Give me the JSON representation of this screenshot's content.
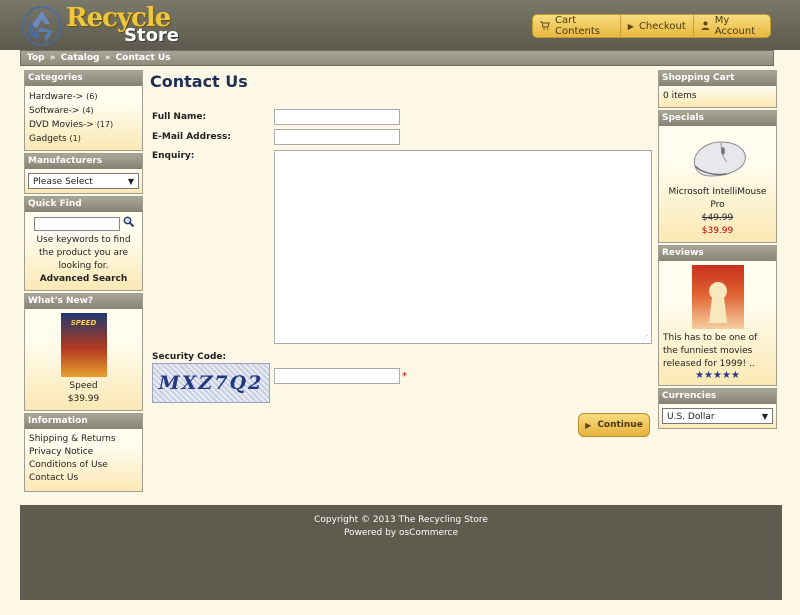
{
  "header": {
    "logo": {
      "line1": "Recycle",
      "line2": "Store"
    },
    "nav": [
      {
        "label": "Cart Contents",
        "icon": "cart-icon"
      },
      {
        "label": "Checkout",
        "icon": "arrow-right-icon"
      },
      {
        "label": "My Account",
        "icon": "person-icon"
      }
    ]
  },
  "breadcrumb": [
    "Top",
    "Catalog",
    "Contact Us"
  ],
  "breadcrumb_separator": "»",
  "left": {
    "categories": {
      "title": "Categories",
      "items": [
        {
          "label": "Hardware->",
          "count": "(6)"
        },
        {
          "label": "Software->",
          "count": "(4)"
        },
        {
          "label": "DVD Movies->",
          "count": "(17)"
        },
        {
          "label": "Gadgets",
          "count": "(1)"
        }
      ]
    },
    "manufacturers": {
      "title": "Manufacturers",
      "selected": "Please Select"
    },
    "quick_find": {
      "title": "Quick Find",
      "help": "Use keywords to find the product you are looking for.",
      "advanced": "Advanced Search"
    },
    "whats_new": {
      "title": "What's New?",
      "product": "Speed",
      "price": "$39.99",
      "cover_text": "SPEED"
    },
    "information": {
      "title": "Information",
      "links": [
        "Shipping & Returns",
        "Privacy Notice",
        "Conditions of Use",
        "Contact Us"
      ]
    }
  },
  "main": {
    "title": "Contact Us",
    "labels": {
      "full_name": "Full Name:",
      "email": "E-Mail Address:",
      "enquiry": "Enquiry:",
      "security": "Security Code:"
    },
    "captcha_text": "MXZ7Q2",
    "required_marker": "*",
    "continue_label": "Continue"
  },
  "right": {
    "cart": {
      "title": "Shopping Cart",
      "items": "0 items"
    },
    "specials": {
      "title": "Specials",
      "product": "Microsoft IntelliMouse Pro",
      "old_price": "$49.99",
      "new_price": "$39.99"
    },
    "reviews": {
      "title": "Reviews",
      "text": "This has to be one of the funniest movies released for 1999! ..",
      "stars": "★★★★★"
    },
    "currencies": {
      "title": "Currencies",
      "selected": "U.S. Dollar"
    }
  },
  "footer": {
    "copyright": "Copyright © 2013 The Recycling Store",
    "powered": "Powered by osCommerce"
  },
  "colors": {
    "accent": "#f0c63a",
    "header_bar": "#8e8c7c",
    "title_blue": "#1f2e55",
    "price_red": "#c00000"
  }
}
